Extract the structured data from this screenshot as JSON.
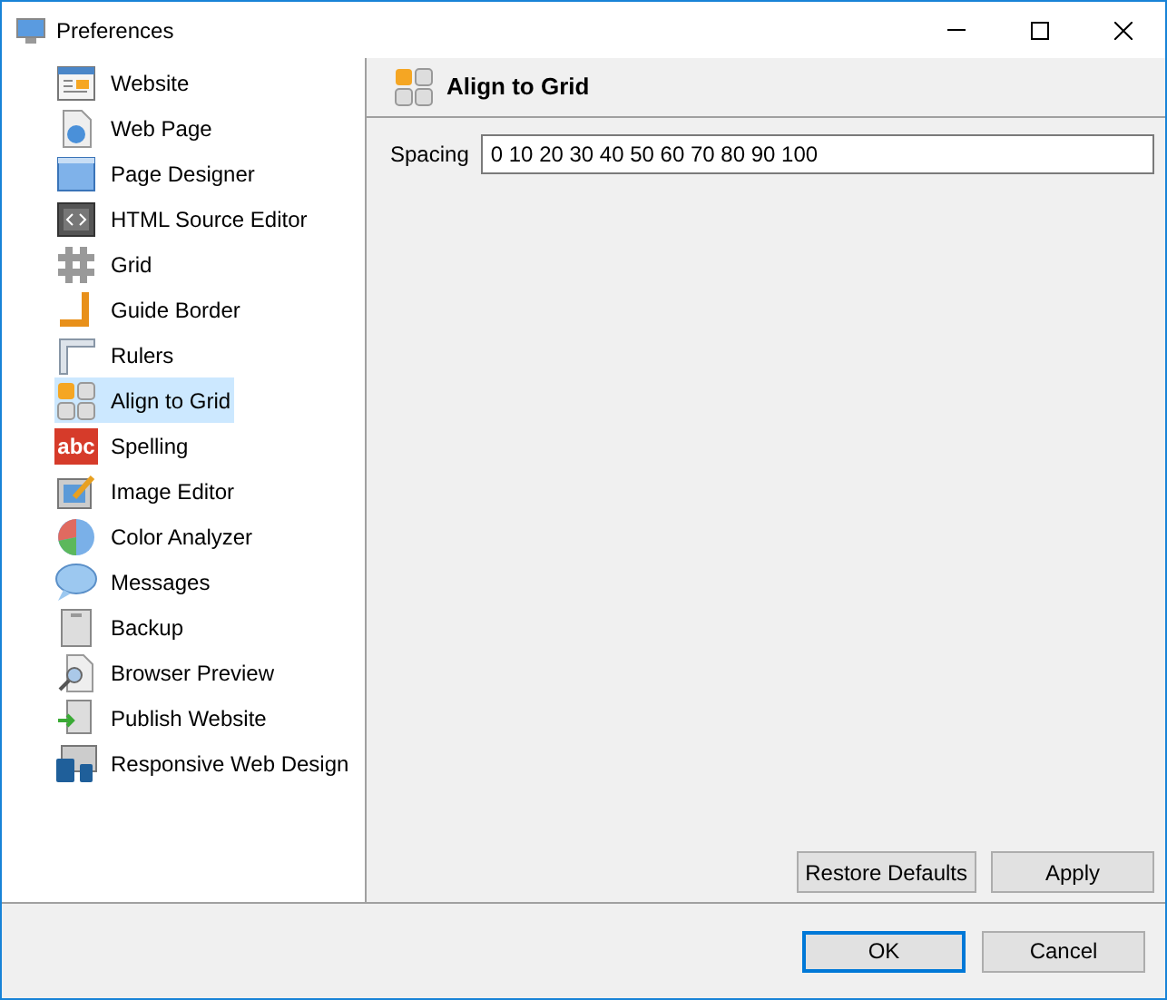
{
  "window": {
    "title": "Preferences"
  },
  "sidebar": {
    "items": [
      {
        "label": "Website",
        "selected": false
      },
      {
        "label": "Web Page",
        "selected": false
      },
      {
        "label": "Page Designer",
        "selected": false
      },
      {
        "label": "HTML Source Editor",
        "selected": false
      },
      {
        "label": "Grid",
        "selected": false
      },
      {
        "label": "Guide Border",
        "selected": false
      },
      {
        "label": "Rulers",
        "selected": false
      },
      {
        "label": "Align to Grid",
        "selected": true
      },
      {
        "label": "Spelling",
        "icon_text": "abc",
        "selected": false
      },
      {
        "label": "Image Editor",
        "selected": false
      },
      {
        "label": "Color Analyzer",
        "selected": false
      },
      {
        "label": "Messages",
        "selected": false
      },
      {
        "label": "Backup",
        "selected": false
      },
      {
        "label": "Browser Preview",
        "selected": false
      },
      {
        "label": "Publish Website",
        "selected": false
      },
      {
        "label": "Responsive Web Design",
        "selected": false
      }
    ]
  },
  "panel": {
    "title": "Align to Grid",
    "fields": [
      {
        "label": "Spacing",
        "value": "0 10 20 30 40 50 60 70 80 90 100"
      }
    ],
    "buttons": [
      "Restore Defaults",
      "Apply"
    ]
  },
  "footer": {
    "buttons": [
      {
        "label": "OK",
        "default": true
      },
      {
        "label": "Cancel",
        "default": false
      }
    ]
  }
}
